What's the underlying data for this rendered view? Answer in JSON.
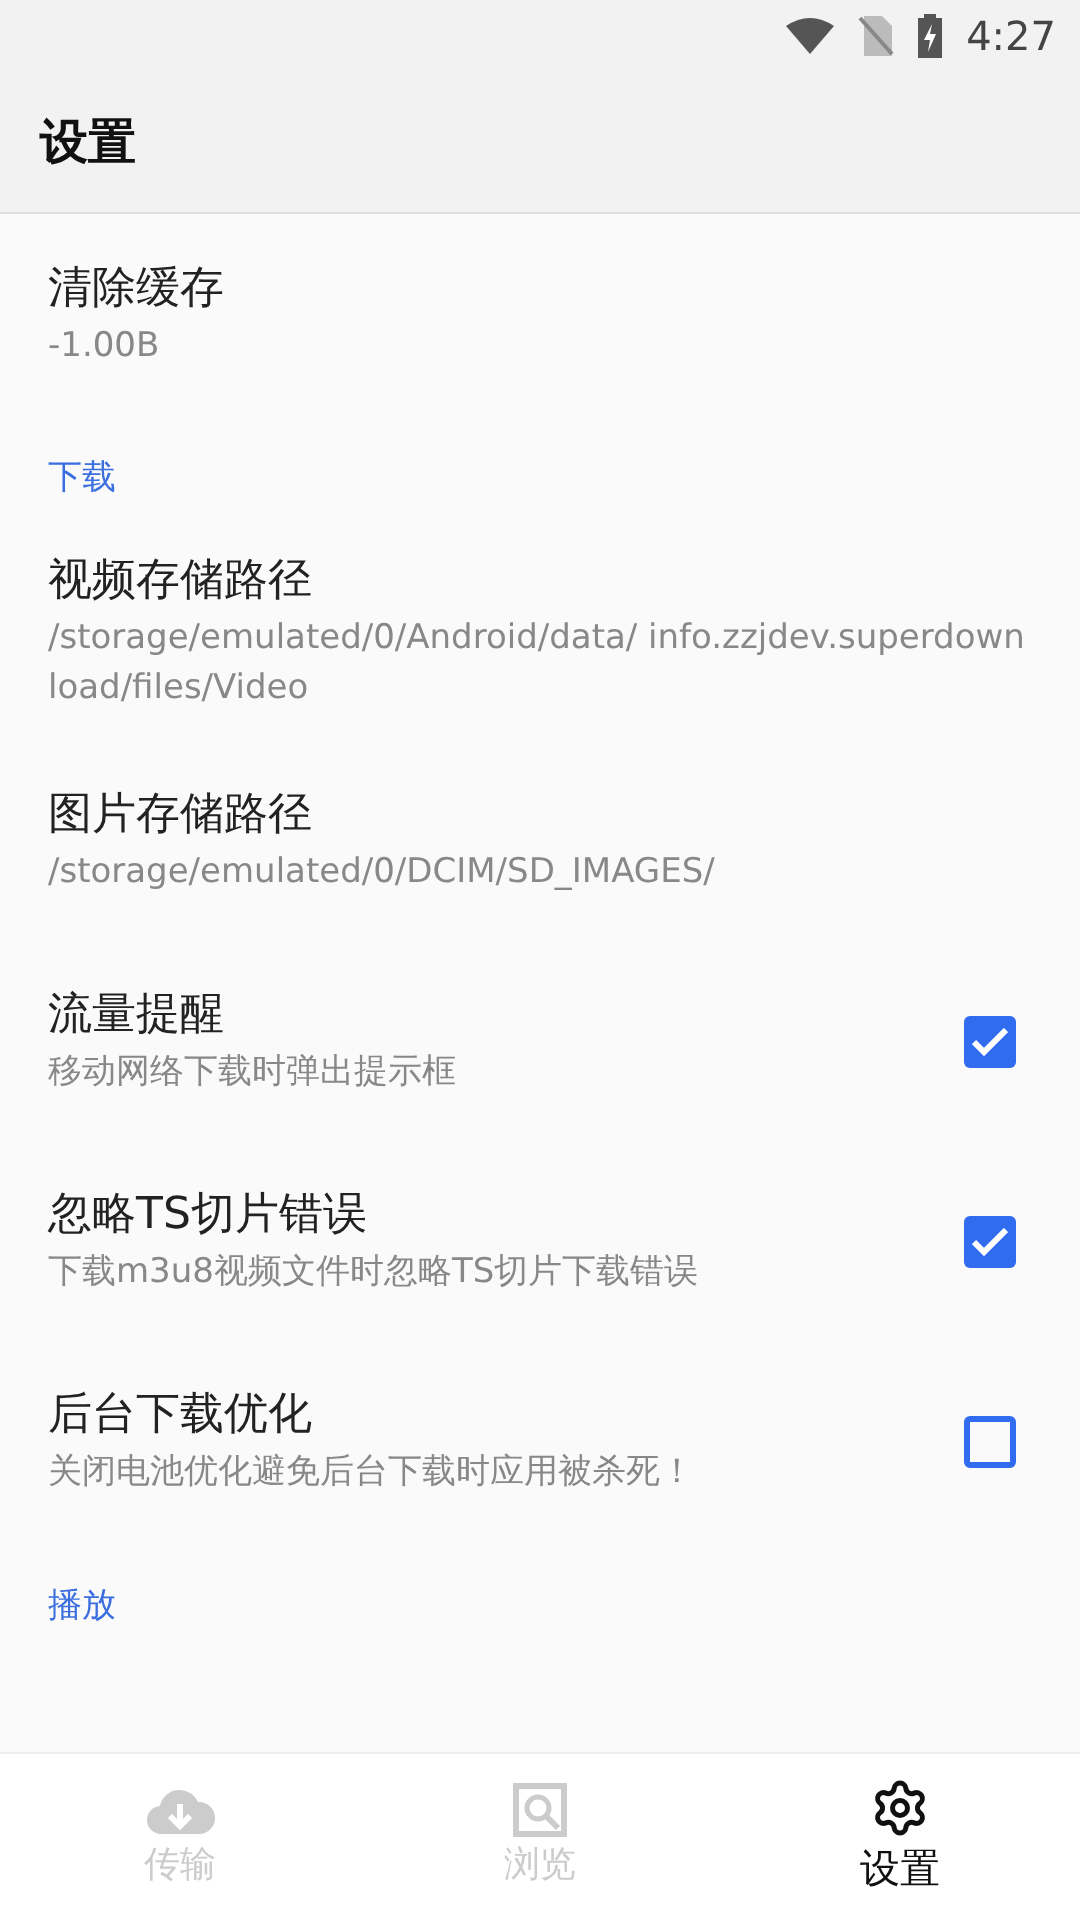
{
  "status_bar": {
    "time": "4:27"
  },
  "app_bar": {
    "title": "设置"
  },
  "items": [
    {
      "kind": "preference",
      "title": "清除缓存",
      "summary": "-1.00B"
    },
    {
      "kind": "section",
      "title": "下载"
    },
    {
      "kind": "preference",
      "title": "视频存储路径",
      "summary": "/storage/emulated/0/Android/data/ info.zzjdev.superdownload/files/Video"
    },
    {
      "kind": "preference",
      "title": "图片存储路径",
      "summary": "/storage/emulated/0/DCIM/SD_IMAGES/"
    },
    {
      "kind": "checkbox",
      "title": "流量提醒",
      "summary": "移动网络下载时弹出提示框",
      "checked": true
    },
    {
      "kind": "checkbox",
      "title": "忽略TS切片错误",
      "summary": "下载m3u8视频文件时忽略TS切片下载错误",
      "checked": true
    },
    {
      "kind": "checkbox",
      "title": "后台下载优化",
      "summary": "关闭电池优化避免后台下载时应用被杀死！",
      "checked": false
    },
    {
      "kind": "section",
      "title": "播放"
    }
  ],
  "nav": [
    {
      "kind": "transfer",
      "label": "传输",
      "selected": false
    },
    {
      "kind": "browse",
      "label": "浏览",
      "selected": false
    },
    {
      "kind": "settings",
      "label": "设置",
      "selected": true
    }
  ]
}
